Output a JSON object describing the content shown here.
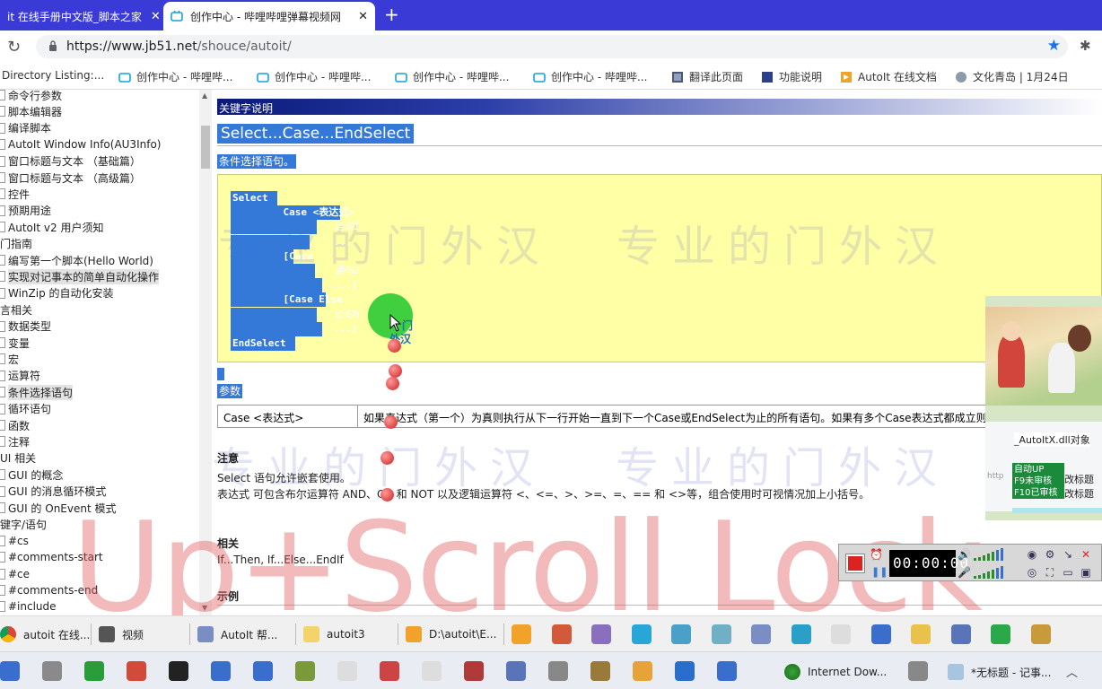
{
  "browser": {
    "tabs": [
      {
        "title": "it 在线手册中文版_脚本之家",
        "close": "✕"
      },
      {
        "title": "创作中心 - 哔哩哔哩弹幕视频网",
        "close": "✕"
      }
    ],
    "new_tab": "+",
    "reload": "↻",
    "url_host": "https://www.jb51.net",
    "url_path": "/shouce/autoit/",
    "star": "★",
    "extensions": "✱",
    "bookmarks": [
      "Directory Listing:...",
      "创作中心 - 哔哩哔...",
      "创作中心 - 哔哩哔...",
      "创作中心 - 哔哩哔...",
      "创作中心 - 哔哩哔...",
      "翻译此页面",
      "功能说明",
      "AutoIt 在线文档",
      "文化青岛 | 1月24日"
    ]
  },
  "sidebar": {
    "items": [
      "命令行参数",
      "脚本编辑器",
      "编译脚本",
      "AutoIt Window Info(AU3Info)",
      "窗口标题与文本 （基础篇）",
      "窗口标题与文本 （高级篇）",
      "控件",
      "预期用途",
      "AutoIt v2 用户须知",
      "门指南",
      "编写第一个脚本(Hello World)",
      "实现对记事本的简单自动化操作",
      "WinZip 的自动化安装",
      "言相关",
      "数据类型",
      "变量",
      "宏",
      "运算符",
      "条件选择语句",
      "循环语句",
      "函数",
      "注释",
      "UI 相关",
      "GUI 的概念",
      "GUI 的消息循环模式",
      "GUI 的 OnEvent 模式",
      "键字/语句",
      "#cs",
      "#comments-start",
      "#ce",
      "#comments-end",
      "#include"
    ],
    "scroll_up": "▲",
    "scroll_down": "▼"
  },
  "content": {
    "keyword_bar": "关键字说明",
    "title": "Select...Case...EndSelect",
    "description": "条件选择语句。",
    "code": [
      {
        "text": "Select",
        "italic": false
      },
      {
        "text": "    Case <表达式>",
        "italic": false
      },
      {
        "text": "        语句1",
        "italic": true
      },
      {
        "text": "        ...",
        "italic": false
      },
      {
        "text": "    [Case",
        "italic": false
      },
      {
        "text": "        语句2",
        "italic": true
      },
      {
        "text": "        ...]",
        "italic": false
      },
      {
        "text": "    [Case Else",
        "italic": false
      },
      {
        "text": "        语句N",
        "italic": true
      },
      {
        "text": "        ...]",
        "italic": false
      },
      {
        "text": "EndSelect",
        "italic": false
      }
    ],
    "param_heading": "参数",
    "param_name": "Case <表达式>",
    "param_desc": "如果表达式（第一个）为真则执行从下一行开始一直到下一个Case或EndSelect为止的所有语句。如果有多个Case表达式都成立则只执行第一个Case语句",
    "notes_heading": "注意",
    "notes_1": "Select 语句允许嵌套使用。",
    "notes_2": "表达式 可包含布尔运算符 AND、OR 和 NOT 以及逻辑运算符 <、<=、>、>=、=、== 和 <>等，组合使用时可视情况加上小括号。",
    "related_heading": "相关",
    "related_text": "If...Then, If...Else...EndIf",
    "example_heading": "示例",
    "link_fragment_1": "门",
    "link_fragment_2": "外汉"
  },
  "watermarks": {
    "seal_text": "专业的门外汉",
    "overlay_text": "Up+Scroll Lock"
  },
  "video_overlay": {
    "label": "_AutoItX.dll对象",
    "green_lines": [
      "自动UP",
      "F9未审核",
      "F10已审核"
    ],
    "buttons": [
      "改标题",
      "改标题"
    ],
    "http_hint": "http"
  },
  "recorder": {
    "timer": "00:00:00",
    "stop_icon": "record-stop",
    "clock_icon": "⏰",
    "pause_icon": "❚❚"
  },
  "taskbar_top": [
    "autoit 在线...",
    "视频",
    "AutoIt 帮...",
    "autoit3",
    "D:\\autoit\\E..."
  ],
  "taskbar_bottom": [
    "Internet Dow...",
    "*无标题 - 记事..."
  ],
  "taskbar_chevron": "︿",
  "colors": {
    "tab_bar": "#3a3ad6",
    "selection": "#3478d8",
    "code_bg": "#ffffa6",
    "watermark_red": "#e15a5a"
  }
}
